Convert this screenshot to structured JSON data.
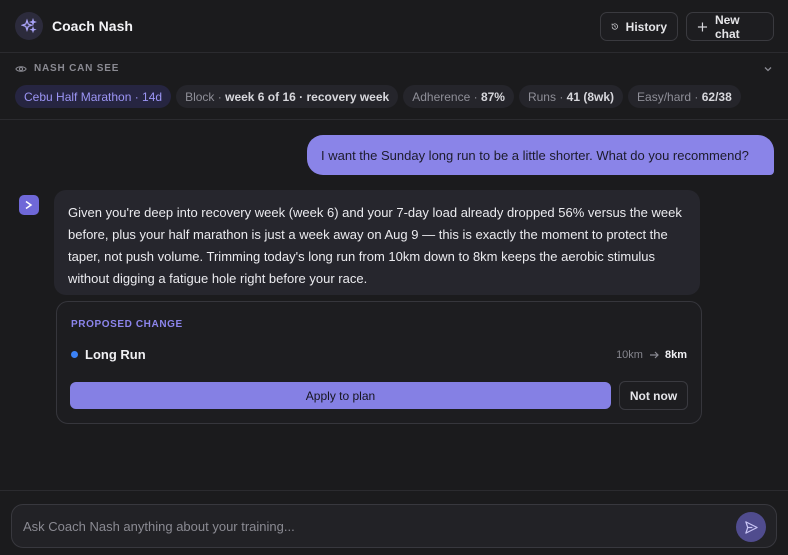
{
  "header": {
    "title": "Coach Nash",
    "history_label": "History",
    "new_chat_label": "New chat"
  },
  "context": {
    "title": "NASH CAN SEE",
    "chips": [
      {
        "text": "Cebu Half Marathon · 14d"
      },
      {
        "label": "Block · ",
        "value": "week 6 of 16 · recovery week"
      },
      {
        "label": "Adherence · ",
        "value": "87%"
      },
      {
        "label": "Runs · ",
        "value": "41 (8wk)"
      },
      {
        "label": "Easy/hard · ",
        "value": "62/38"
      }
    ]
  },
  "messages": {
    "user": "I want the Sunday long run to be a little shorter. What do you recommend?",
    "assistant": "Given you're deep into recovery week (week 6) and your 7-day load already dropped 56% versus the week before, plus your half marathon is just a week away on Aug 9 — this is exactly the moment to protect the taper, not push volume. Trimming today's long run from 10km down to 8km keeps the aerobic stimulus without digging a fatigue hole right before your race."
  },
  "proposal": {
    "label": "PROPOSED CHANGE",
    "workout": "Long Run",
    "from": "10km",
    "to": "8km",
    "apply_label": "Apply to plan",
    "dismiss_label": "Not now"
  },
  "composer": {
    "placeholder": "Ask Coach Nash anything about your training..."
  },
  "colors": {
    "accent": "#8a84e8",
    "background": "#1b1b1d",
    "dot": "#3b82f6"
  }
}
